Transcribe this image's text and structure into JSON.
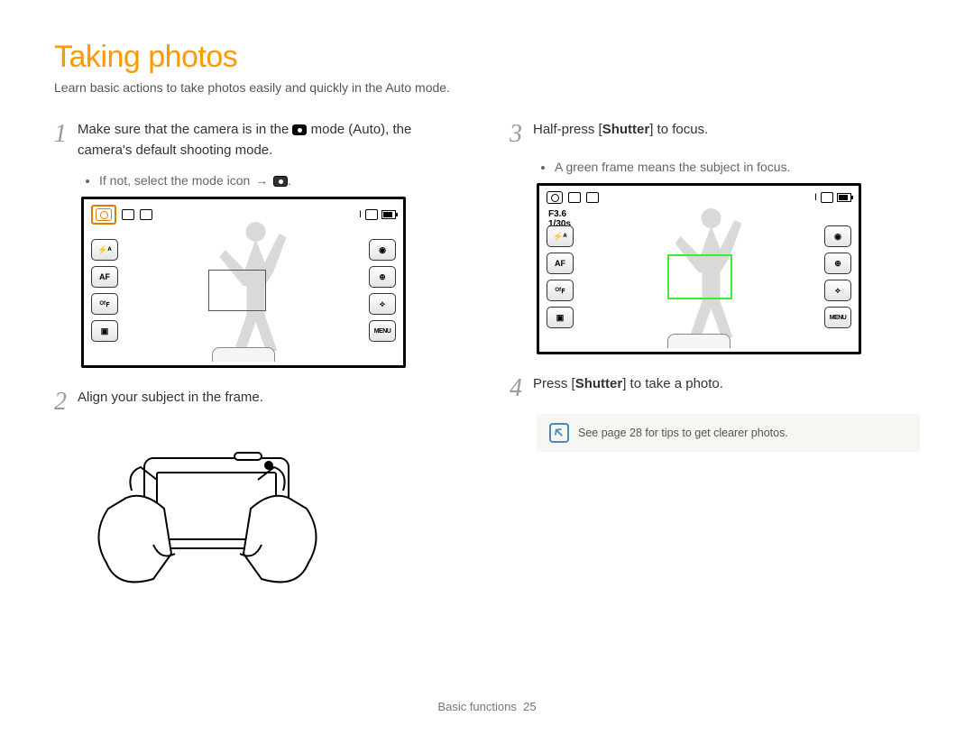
{
  "page": {
    "title": "Taking photos",
    "subtitle": "Learn basic actions to take photos easily and quickly in the Auto mode.",
    "footer_section": "Basic functions",
    "footer_page": "25"
  },
  "left": {
    "step1": {
      "num": "1",
      "text_pre": "Make sure that the camera is in the ",
      "text_mid": " mode (Auto), the camera's default shooting mode.",
      "bullet_pre": "If not, select the mode icon ",
      "arrow": "→",
      "bullet_post": "."
    },
    "step2": {
      "num": "2",
      "text": "Align your subject in the frame."
    }
  },
  "right": {
    "step3": {
      "num": "3",
      "text_a": "Half-press [",
      "text_b": "Shutter",
      "text_c": "] to focus.",
      "bullet": "A green frame means the subject in focus."
    },
    "step4": {
      "num": "4",
      "text_a": "Press [",
      "text_b": "Shutter",
      "text_c": "] to take a photo."
    },
    "note": "See page 28 for tips to get clearer photos."
  },
  "screen": {
    "btn_flash": "⚡ᴬ",
    "btn_af": "AF",
    "btn_off": "ᴼᶠꜰ",
    "btn_disp": "▣",
    "btn_rec": "◉",
    "btn_globe": "⊕",
    "btn_wifi": "⟡",
    "btn_menu": "MENU",
    "top_bar_i": "I",
    "exposure_f": "F3.6",
    "exposure_s": "1/30s"
  }
}
